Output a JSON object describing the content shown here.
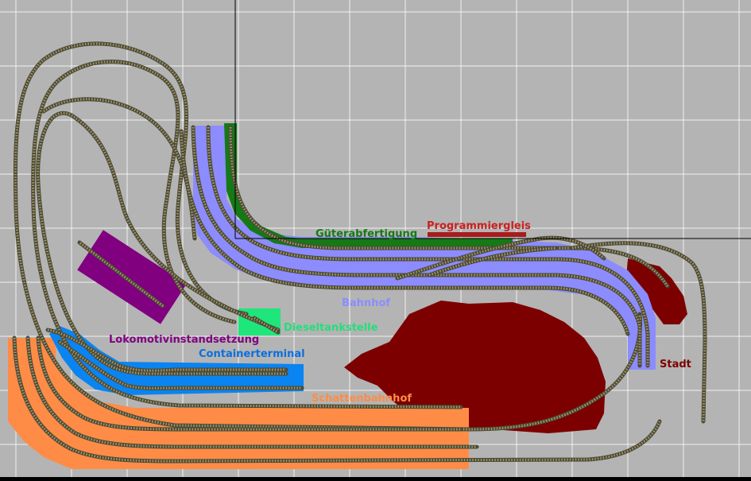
{
  "canvas": {
    "background": "#b4b4b4",
    "grid_color": "#ffffff",
    "border_color": "#000000"
  },
  "track": {
    "rail_color": "#4a4a3a",
    "tie_color": "#a89860"
  },
  "zones": {
    "lokomotivinstandsetzung": {
      "label": "Lokomotivinstandsetzung",
      "color": "#800080",
      "text_color": "#800080"
    },
    "containerterminal": {
      "label": "Containerterminal",
      "color": "#0a84f0",
      "text_color": "#0a6fe0"
    },
    "schattenbahnhof": {
      "label": "Schattenbahnhof",
      "color": "#ff8c46",
      "text_color": "#ff8c46"
    },
    "bahnhof": {
      "label": "Bahnhof",
      "color": "#8c8cff",
      "text_color": "#8c8cff"
    },
    "gueterabfertigung": {
      "label": "Güterabfertigung",
      "color": "#157a15",
      "text_color": "#157a15"
    },
    "programmiergleis": {
      "label": "Programmiergleis",
      "color": "#aa1c1c",
      "text_color": "#cc2020"
    },
    "dieseltankstelle": {
      "label": "Dieseltankstelle",
      "color": "#1ee67a",
      "text_color": "#22e07a"
    },
    "stadt": {
      "label": "Stadt",
      "color": "#7d0000",
      "text_color": "#7d0000"
    }
  }
}
